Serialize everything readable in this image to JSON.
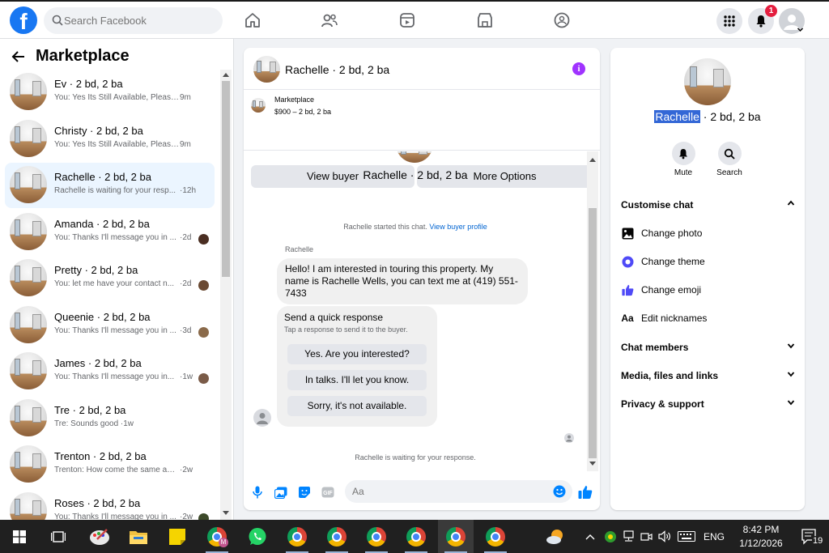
{
  "topbar": {
    "logo": "f",
    "search_placeholder": "Search Facebook",
    "notif_count": "1"
  },
  "left": {
    "title": "Marketplace",
    "conversations": [
      {
        "name": "Ev · 2 bd, 2 ba",
        "preview": "You: Yes Its Still Available, Please ...",
        "time": "9m"
      },
      {
        "name": "Christy · 2 bd, 2 ba",
        "preview": "You: Yes Its Still Available, Please ...",
        "time": "9m"
      },
      {
        "name": "Rachelle · 2 bd, 2 ba",
        "preview": "Rachelle is waiting for your resp...",
        "time": "·12h"
      },
      {
        "name": "Amanda · 2 bd, 2 ba",
        "preview": "You: Thanks I'll message you in ...",
        "time": "·2d"
      },
      {
        "name": "Pretty · 2 bd, 2 ba",
        "preview": "You: let me have your contact n...",
        "time": "·2d"
      },
      {
        "name": "Queenie · 2 bd, 2 ba",
        "preview": "You: Thanks I'll message you in ...",
        "time": "·3d"
      },
      {
        "name": "James · 2 bd, 2 ba",
        "preview": "You: Thanks I'll message you in...",
        "time": "·1w"
      },
      {
        "name": "Tre · 2 bd, 2 ba",
        "preview": "Tre: Sounds good ·1w",
        "time": ""
      },
      {
        "name": "Trenton · 2 bd, 2 ba",
        "preview": "Trenton: How come the same add...",
        "time": "·2w"
      },
      {
        "name": "Roses · 2 bd, 2 ba",
        "preview": "You: Thanks I'll message you in ...",
        "time": "·2w"
      }
    ]
  },
  "chat": {
    "title": "Rachelle · 2 bd, 2 ba",
    "listing_source": "Marketplace",
    "listing_price": "$900 – 2 bd, 2 ba",
    "view_buyer": "View buyer",
    "more_options": "More Options",
    "header_name": "Rachelle · 2 bd, 2 ba",
    "started_text": "Rachelle started this chat.",
    "view_profile": "View buyer profile",
    "sender": "Rachelle",
    "message": "Hello! I am interested in touring this property. My name is Rachelle Wells, you can text me at (419) 551-7433",
    "quick_title": "Send a quick response",
    "quick_sub": "Tap a response to send it to the buyer.",
    "quick_responses": [
      "Yes. Are you interested?",
      "In talks. I'll let you know.",
      "Sorry, it's not available."
    ],
    "waiting": "Rachelle is waiting for your response.",
    "composer_placeholder": "Aa"
  },
  "right": {
    "name_first": "Rachelle",
    "name_rest": " · 2 bd, 2 ba",
    "mute": "Mute",
    "search": "Search",
    "customise": "Customise chat",
    "options": [
      "Change photo",
      "Change theme",
      "Change emoji",
      "Edit nicknames"
    ],
    "members": "Chat members",
    "media": "Media, files and links",
    "privacy": "Privacy & support"
  },
  "taskbar": {
    "lang": "ENG",
    "time": "8:42 PM",
    "date": "1/12/2026",
    "notif": "19"
  },
  "colors": {
    "brand": "#1877f2",
    "accent": "#0084ff",
    "theme": "#a033ff"
  }
}
